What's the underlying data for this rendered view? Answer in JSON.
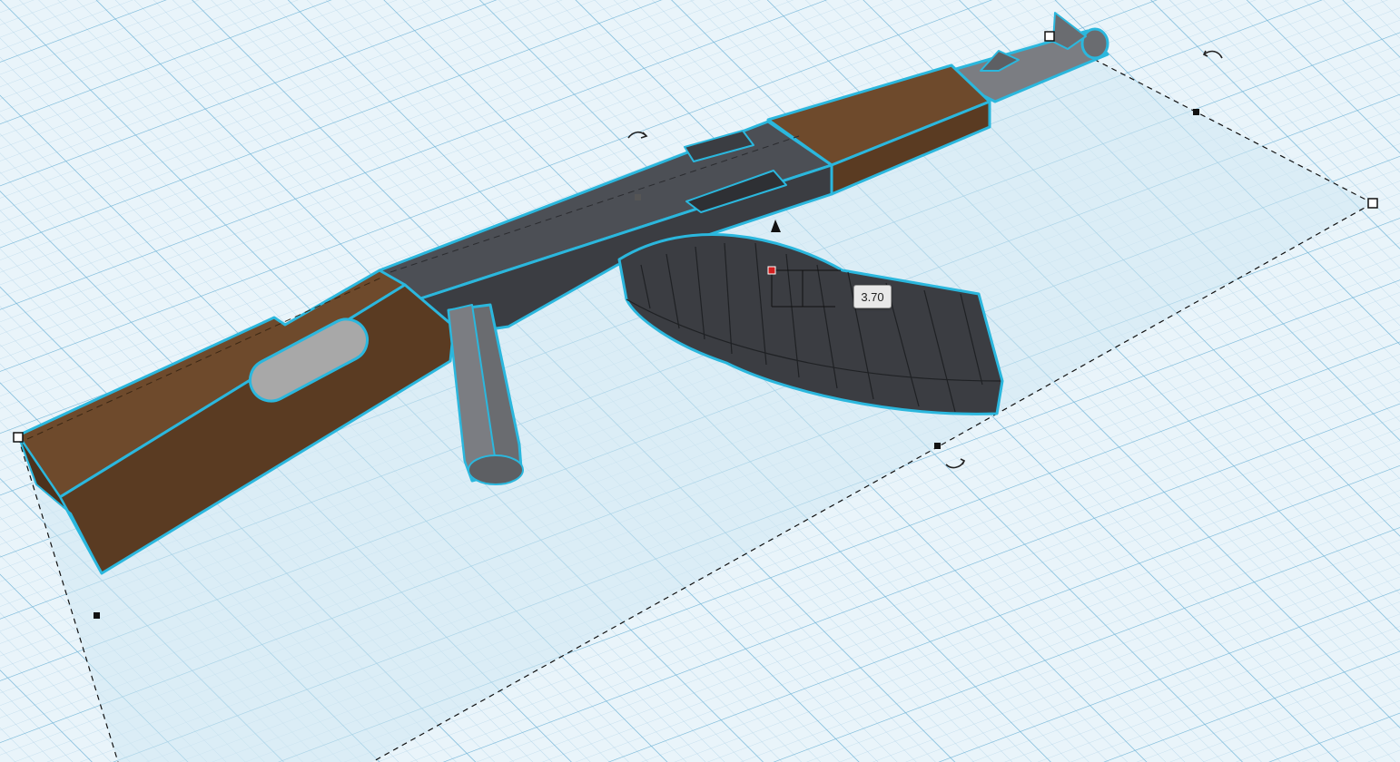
{
  "viewport": {
    "height_dimension_value": "3.70",
    "icons": {
      "rotate": "rotate-arrow-icon",
      "lift": "lift-cone-icon",
      "resize": "resize-handle-icon"
    }
  },
  "colors": {
    "workplane": "#e9f4fa",
    "grid_minor": "#b8d8ea",
    "grid_major": "#74b6d8",
    "selection_shadow": "#cfe7f3",
    "selection_outline": "#2bb7dd",
    "wood": "#6e4a2c",
    "wood_dark": "#5a3b22",
    "metal_dark": "#3b3d42",
    "metal_mid": "#4c4f55",
    "metal_light": "#7b7d82",
    "grey_part": "#a8a8a8",
    "handle_marker": "#d21f1f"
  }
}
